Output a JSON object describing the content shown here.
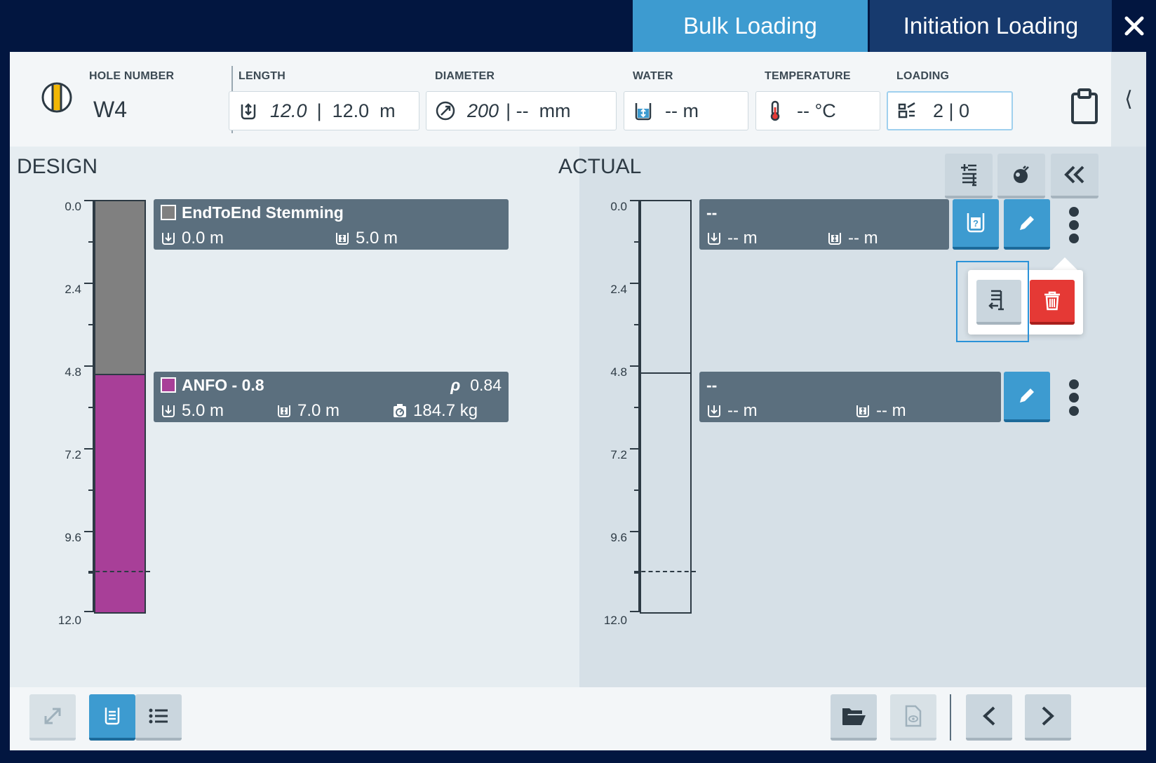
{
  "tabs": {
    "bulk_label": "Bulk Loading",
    "initiation_label": "Initiation Loading"
  },
  "header": {
    "hole_number_label": "HOLE NUMBER",
    "hole_number": "W4",
    "length_label": "LENGTH",
    "length_value": "12.0",
    "length_rest": "|  12.0  m",
    "diameter_label": "DIAMETER",
    "diameter_value": "200",
    "diameter_rest": "| --  mm",
    "water_label": "WATER",
    "water_value": "-- m",
    "temperature_label": "TEMPERATURE",
    "temperature_value": "-- °C",
    "loading_label": "LOADING",
    "loading_value": "2 | 0",
    "collapse_glyph": "⟨"
  },
  "design": {
    "title": "DESIGN",
    "ticks": [
      "0.0",
      "2.4",
      "4.8",
      "7.2",
      "9.6",
      "12.0"
    ],
    "decks": [
      {
        "name": "EndToEnd Stemming",
        "color": "#808080",
        "top": "0.0 m",
        "length": "5.0 m"
      },
      {
        "name": "ANFO - 0.8",
        "color": "#a83f98",
        "density_symbol": "ρ",
        "density": "0.84",
        "top": "5.0 m",
        "length": "7.0 m",
        "mass": "184.7 kg"
      }
    ]
  },
  "actual": {
    "title": "ACTUAL",
    "ticks": [
      "0.0",
      "2.4",
      "4.8",
      "7.2",
      "9.6",
      "12.0"
    ],
    "decks": [
      {
        "name": "--",
        "top": "-- m",
        "length": "-- m"
      },
      {
        "name": "--",
        "top": "-- m",
        "length": "-- m"
      }
    ]
  },
  "colors": {
    "accent": "#3d9bd0",
    "delete": "#e53935",
    "stemming": "#808080",
    "anfo": "#a83f98"
  }
}
